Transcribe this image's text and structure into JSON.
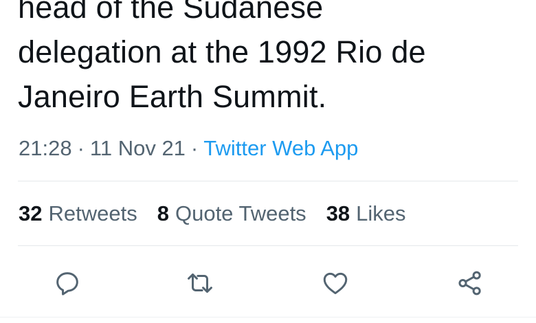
{
  "tweet": {
    "text_lines": [
      "head of the Sudanese",
      "delegation at the 1992 Rio de",
      "Janeiro Earth Summit."
    ],
    "time": "21:28",
    "date": "11 Nov 21",
    "separator": "·",
    "source": "Twitter Web App"
  },
  "stats": {
    "retweets_count": "32",
    "retweets_label": "Retweets",
    "quotes_count": "8",
    "quotes_label": "Quote Tweets",
    "likes_count": "38",
    "likes_label": "Likes"
  },
  "actions": {
    "reply_icon": "reply-icon",
    "retweet_icon": "retweet-icon",
    "like_icon": "heart-icon",
    "share_icon": "share-icon"
  },
  "colors": {
    "text": "#0f1419",
    "secondary": "#536471",
    "link": "#1d9bf0",
    "divider": "#e4e8eb"
  }
}
